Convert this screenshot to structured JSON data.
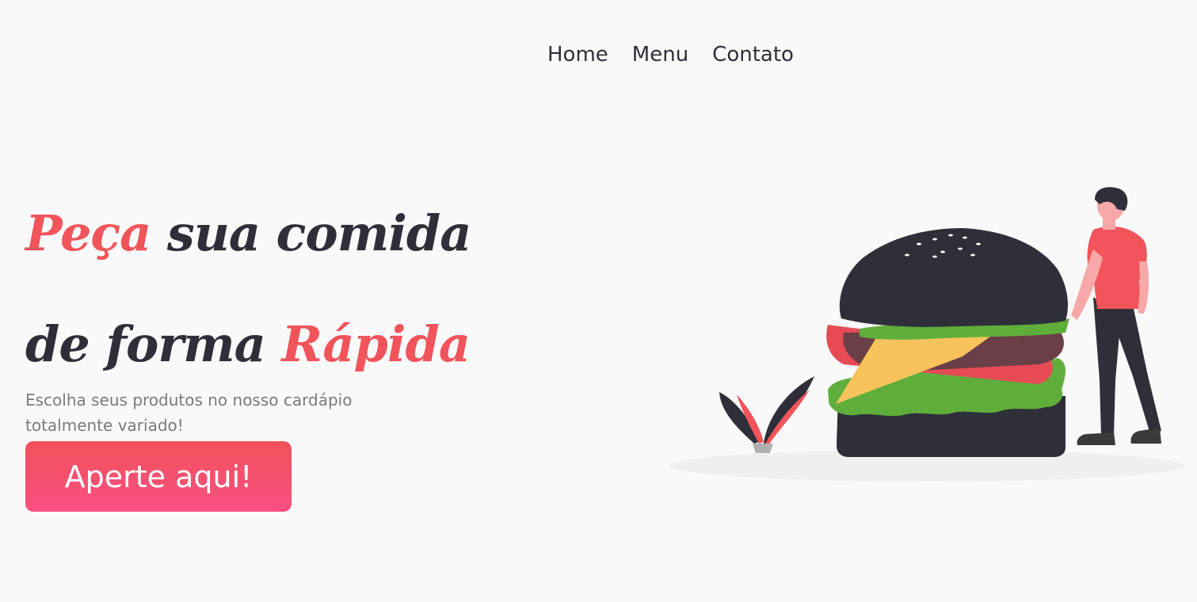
{
  "nav": {
    "items": [
      {
        "label": "Home"
      },
      {
        "label": "Menu"
      },
      {
        "label": "Contato"
      }
    ]
  },
  "hero": {
    "title_line1_accent": "Peça",
    "title_line1_rest": " sua comida",
    "title_line2_start": "de forma ",
    "title_line2_accent": "Rápida",
    "subtitle": "Escolha seus produtos no nosso cardápio totalmente variado!",
    "cta_label": "Aperte aqui!"
  },
  "colors": {
    "accent": "#f1545a",
    "text_dark": "#2e2f38",
    "button_gradient_top": "#f1525b",
    "button_gradient_bottom": "#fa4f82",
    "background": "#f9f9f9"
  },
  "illustration": {
    "icon": "burger-with-person-illustration"
  }
}
